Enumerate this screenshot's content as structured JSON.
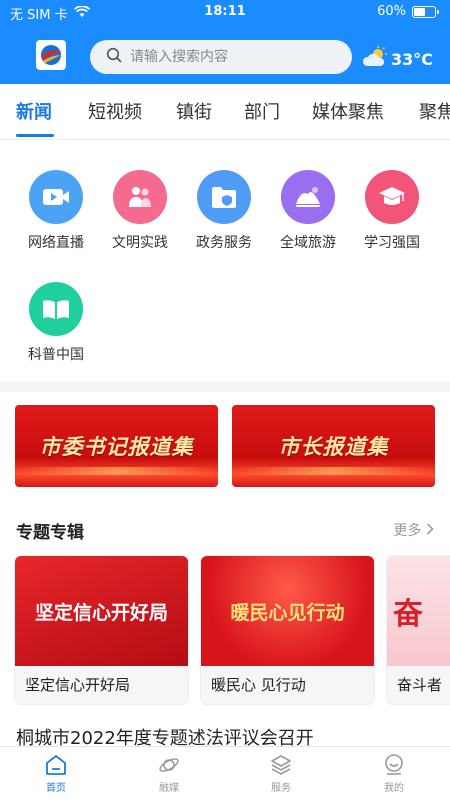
{
  "status_bar": {
    "carrier": "无 SIM 卡",
    "time": "18:11",
    "battery": "60%",
    "battery_level": 0.6
  },
  "header": {
    "search_placeholder": "请输入搜索内容",
    "weather_temp": "33°C",
    "weather_icon": "partly-cloudy-icon"
  },
  "tabs": [
    "新闻",
    "短视频",
    "镇街",
    "部门",
    "媒体聚焦",
    "聚焦"
  ],
  "active_tab": 0,
  "services": [
    {
      "label": "网络直播",
      "icon": "video-icon",
      "color": "#4aa3f5"
    },
    {
      "label": "文明实践",
      "icon": "people-icon",
      "color": "#f56b8f"
    },
    {
      "label": "政务服务",
      "icon": "folder-shield-icon",
      "color": "#4f9cf7"
    },
    {
      "label": "全域旅游",
      "icon": "mountain-icon",
      "color": "#9a6ef0"
    },
    {
      "label": "学习强国",
      "icon": "graduation-cap-icon",
      "color": "#f2547a"
    },
    {
      "label": "科普中国",
      "icon": "book-icon",
      "color": "#1fcf9e"
    }
  ],
  "banners": [
    {
      "text": "市委书记报道集"
    },
    {
      "text": "市长报道集"
    }
  ],
  "section": {
    "title": "专题专辑",
    "more": "更多"
  },
  "albums": [
    {
      "image_text": "坚定信心开好局",
      "caption": "坚定信心开好局"
    },
    {
      "image_text": "暖民心见行动",
      "caption": "暖民心 见行动"
    },
    {
      "image_text": "奋",
      "caption": "奋斗者"
    }
  ],
  "headline": "桐城市2022年度专题述法评议会召开",
  "bottom_nav": [
    {
      "label": "首页",
      "icon": "home-icon"
    },
    {
      "label": "融媒",
      "icon": "orbit-icon"
    },
    {
      "label": "服务",
      "icon": "layers-icon"
    },
    {
      "label": "我的",
      "icon": "smiley-user-icon"
    }
  ],
  "colors": {
    "brand_blue": "#1a8cff",
    "active_blue": "#1a7ae6",
    "banner_red": "#d4141a"
  }
}
